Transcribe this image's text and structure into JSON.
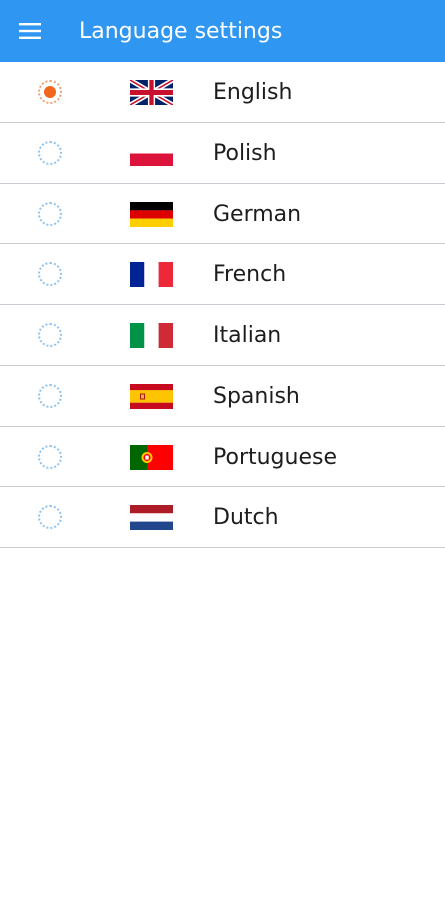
{
  "app_bar": {
    "title": "Language settings",
    "background": "#2f96f1",
    "menu_icon": "hamburger-menu-icon"
  },
  "languages": [
    {
      "label": "English",
      "flag": "uk-flag-icon",
      "selected": true
    },
    {
      "label": "Polish",
      "flag": "poland-flag-icon",
      "selected": false
    },
    {
      "label": "German",
      "flag": "germany-flag-icon",
      "selected": false
    },
    {
      "label": "French",
      "flag": "france-flag-icon",
      "selected": false
    },
    {
      "label": "Italian",
      "flag": "italy-flag-icon",
      "selected": false
    },
    {
      "label": "Spanish",
      "flag": "spain-flag-icon",
      "selected": false
    },
    {
      "label": "Portuguese",
      "flag": "portugal-flag-icon",
      "selected": false
    },
    {
      "label": "Dutch",
      "flag": "netherlands-flag-icon",
      "selected": false
    }
  ],
  "colors": {
    "radio_selected": "#f2661b",
    "radio_unselected_ring": "#8fc3ee",
    "divider": "#c8ccd2"
  }
}
